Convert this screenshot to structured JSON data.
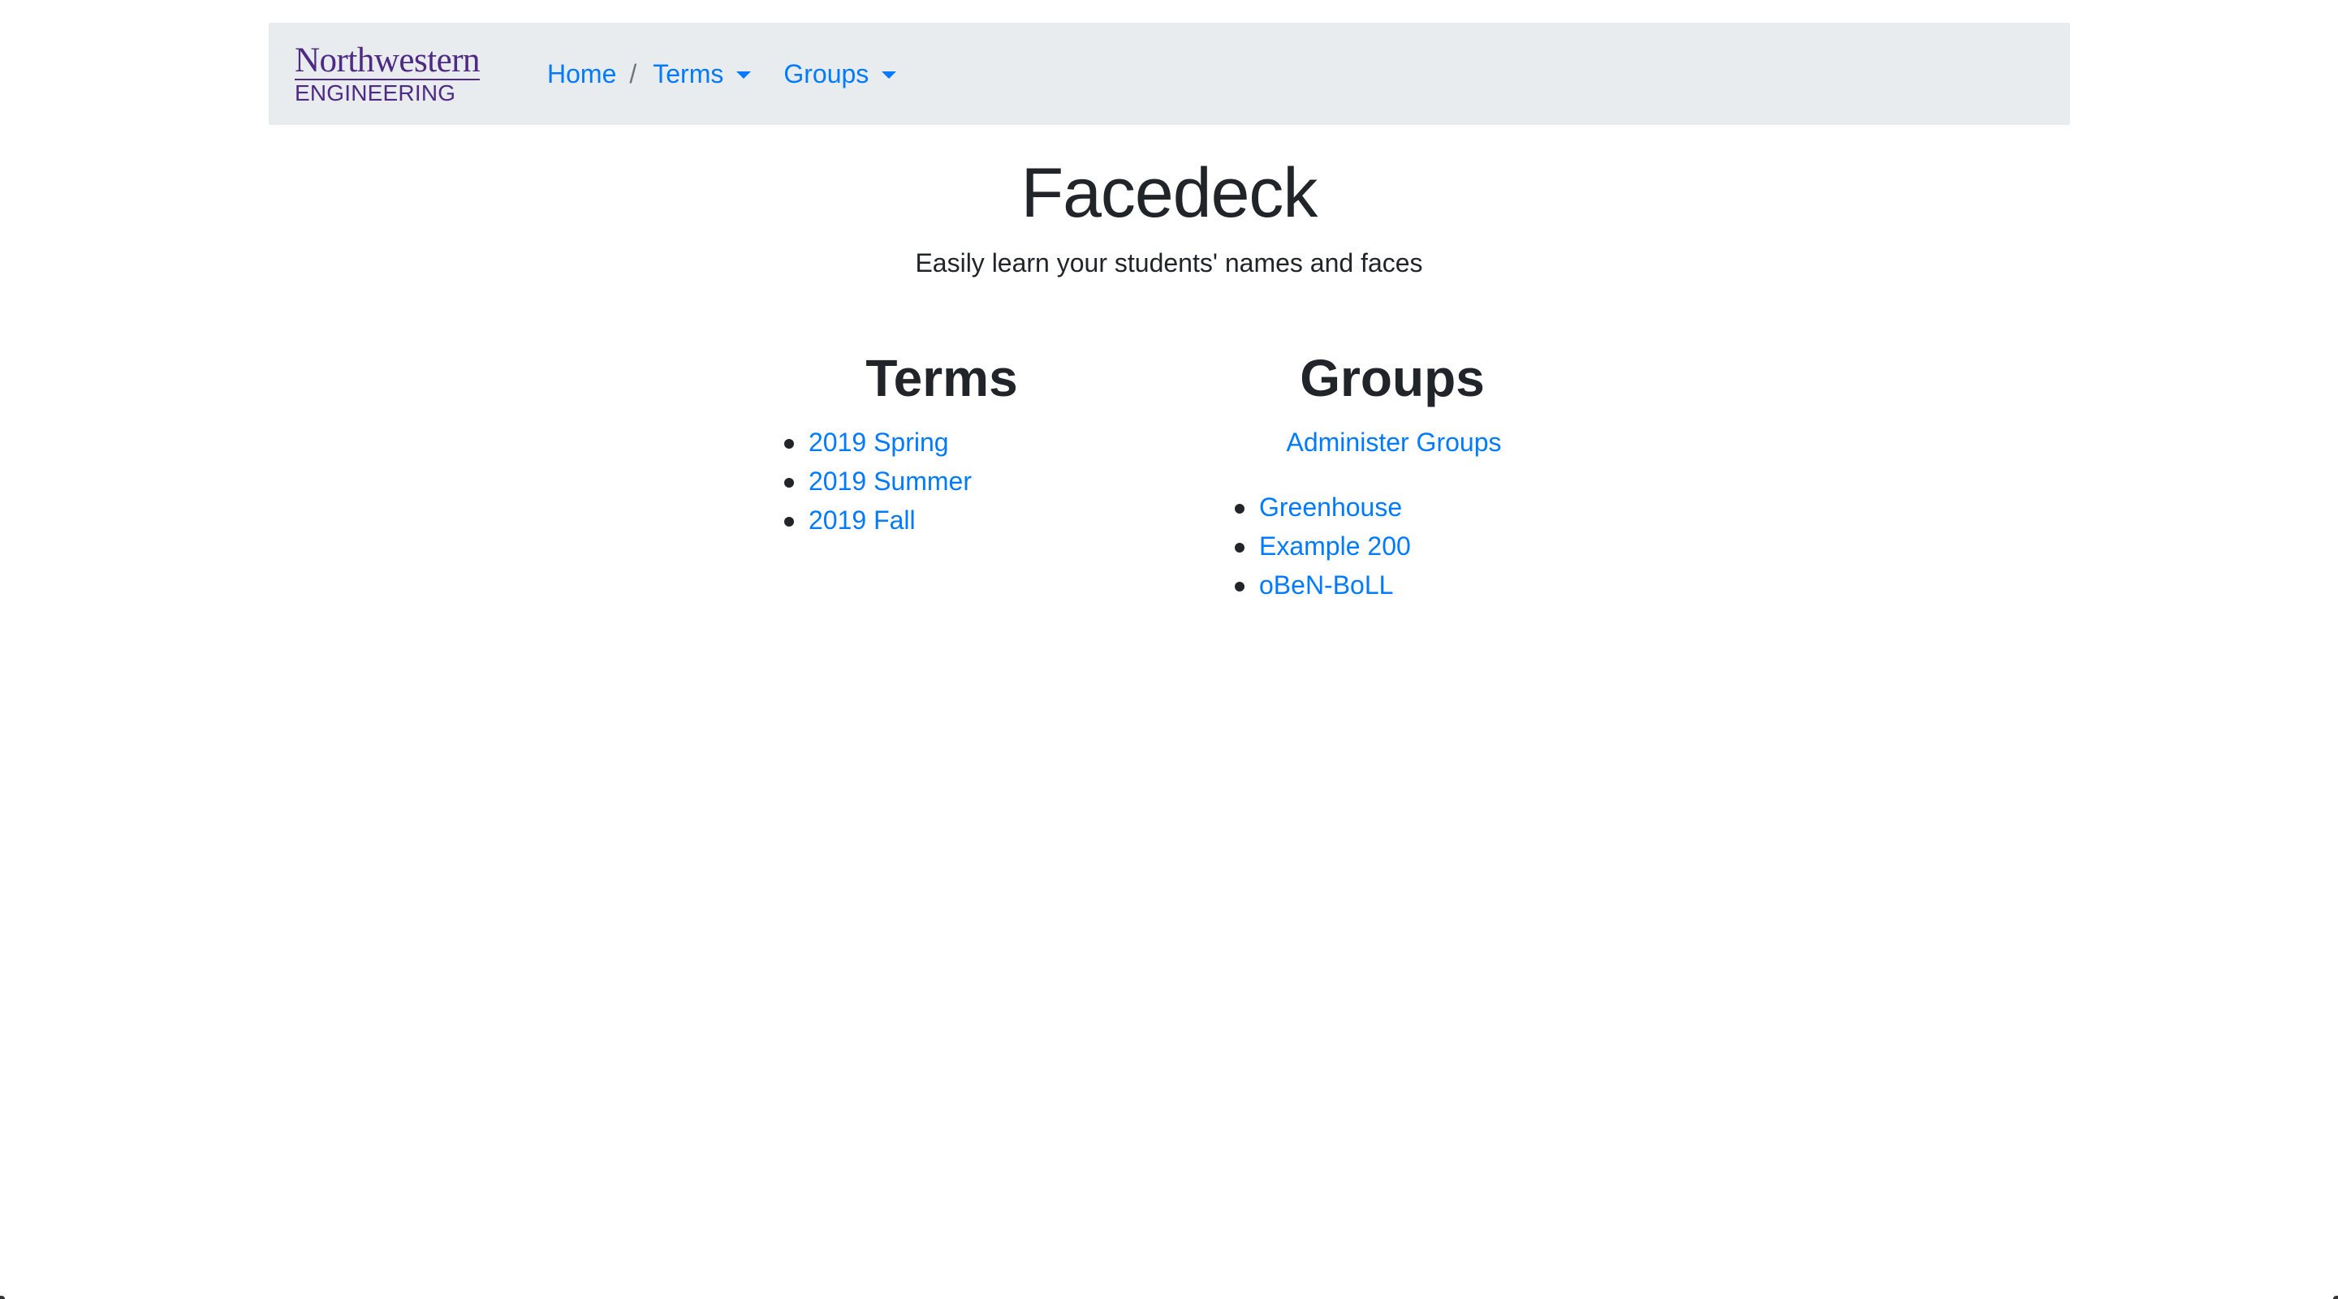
{
  "navbar": {
    "logo": {
      "line1": "Northwestern",
      "line2": "ENGINEERING"
    },
    "home_label": "Home",
    "separator": "/",
    "terms_label": "Terms",
    "groups_label": "Groups"
  },
  "hero": {
    "title": "Facedeck",
    "subtitle": "Easily learn your students' names and faces"
  },
  "terms": {
    "heading": "Terms",
    "items": [
      "2019 Spring",
      "2019 Summer",
      "2019 Fall"
    ]
  },
  "groups": {
    "heading": "Groups",
    "admin_label": "Administer Groups",
    "items": [
      "Greenhouse",
      "Example 200",
      "oBeN-BoLL"
    ]
  },
  "colors": {
    "link": "#007bff",
    "navbar_bg": "#e9ecef",
    "brand_purple": "#4e2a84",
    "text": "#212529"
  }
}
